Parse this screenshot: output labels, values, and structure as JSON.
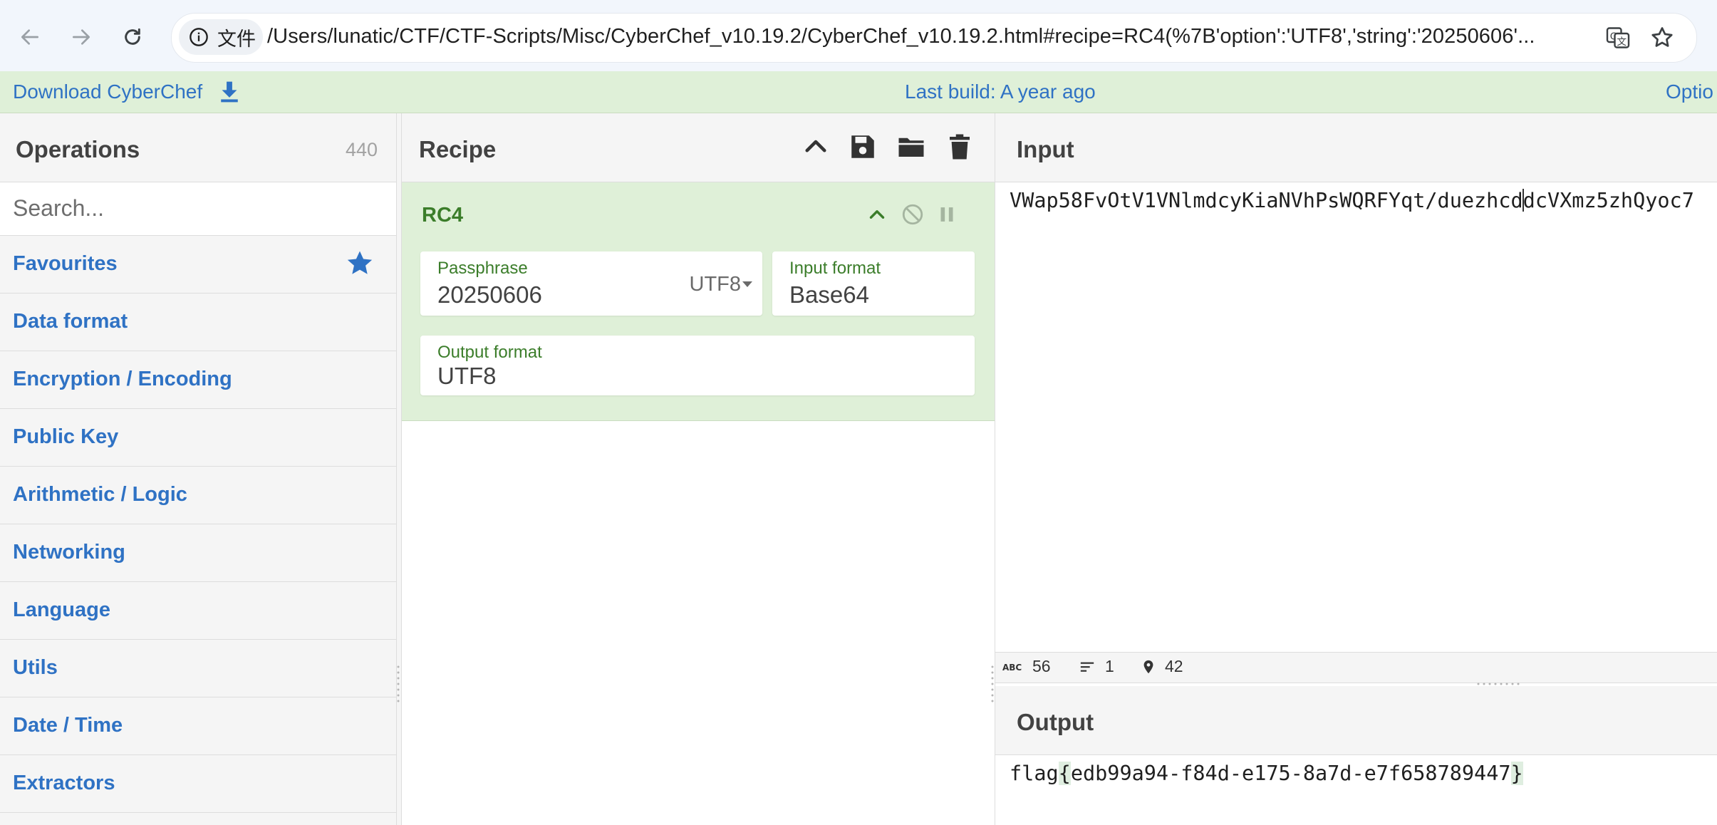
{
  "browser": {
    "site_chip_label": "文件",
    "url": "/Users/lunatic/CTF/CTF-Scripts/Misc/CyberChef_v10.19.2/CyberChef_v10.19.2.html#recipe=RC4(%7B'option':'UTF8','string':'20250606'..."
  },
  "banner": {
    "download_label": "Download CyberChef",
    "last_build": "Last build: A year ago",
    "options_label": "Optio"
  },
  "operations": {
    "title": "Operations",
    "count": "440",
    "search_placeholder": "Search...",
    "categories": [
      "Favourites",
      "Data format",
      "Encryption / Encoding",
      "Public Key",
      "Arithmetic / Logic",
      "Networking",
      "Language",
      "Utils",
      "Date / Time",
      "Extractors"
    ]
  },
  "recipe": {
    "title": "Recipe",
    "operation": {
      "name": "RC4",
      "passphrase_label": "Passphrase",
      "passphrase_value": "20250606",
      "passphrase_encoding": "UTF8",
      "input_format_label": "Input format",
      "input_format_value": "Base64",
      "output_format_label": "Output format",
      "output_format_value": "UTF8"
    }
  },
  "input": {
    "title": "Input",
    "text_before_caret": "VWap58FvOtV1VNlmdcyKiaNVhPsWQRFYqt/duezhcd",
    "text_after_caret": "dcVXmz5zhQyoc7",
    "stats": {
      "length": "56",
      "lines": "1",
      "position": "42"
    }
  },
  "output": {
    "title": "Output",
    "prefix": "flag",
    "open_brace": "{",
    "body": "edb99a94-f84d-e175-8a7d-e7f658789447",
    "close_brace": "}"
  },
  "colors": {
    "accent_blue": "#2f72c4",
    "banner_green": "#dff0d8",
    "op_green": "#3b7d2a"
  }
}
